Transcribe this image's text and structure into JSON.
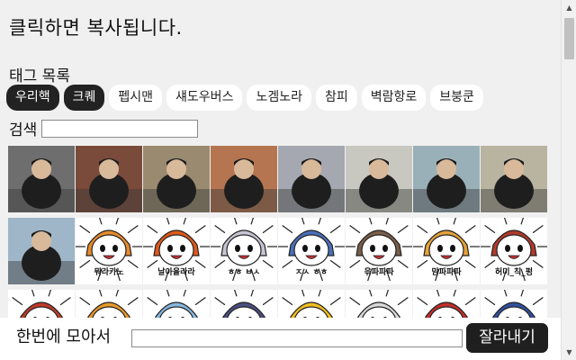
{
  "header": {
    "title": "클릭하면 복사됩니다."
  },
  "tags": {
    "heading": "태그 목록",
    "items": [
      {
        "label": "우리핵",
        "selected": true
      },
      {
        "label": "크퀘",
        "selected": true
      },
      {
        "label": "펩시맨",
        "selected": false
      },
      {
        "label": "섀도우버스",
        "selected": false
      },
      {
        "label": "노겜노라",
        "selected": false
      },
      {
        "label": "참피",
        "selected": false
      },
      {
        "label": "벽람항로",
        "selected": false
      },
      {
        "label": "브붕쿤",
        "selected": false
      }
    ]
  },
  "search": {
    "label": "검색",
    "value": ""
  },
  "stickers": {
    "row1": [
      {
        "name": "photo-1",
        "kind": "photo",
        "bg": "#6e6e6e"
      },
      {
        "name": "photo-2",
        "kind": "photo",
        "bg": "#7a4a3a"
      },
      {
        "name": "photo-3",
        "kind": "photo",
        "bg": "#9a8a70"
      },
      {
        "name": "photo-4",
        "kind": "photo",
        "bg": "#b57550"
      },
      {
        "name": "photo-5",
        "kind": "photo",
        "bg": "#a5a8b0"
      },
      {
        "name": "photo-6",
        "kind": "photo",
        "bg": "#c8c8c0"
      },
      {
        "name": "photo-7",
        "kind": "photo",
        "bg": "#9ab0b8"
      },
      {
        "name": "photo-8",
        "kind": "photo",
        "bg": "#b8b4a0"
      }
    ],
    "row2": [
      {
        "name": "photo-9",
        "kind": "photo",
        "bg": "#9eb6c8",
        "caption": ""
      },
      {
        "name": "cartoon-1",
        "kind": "cartoon",
        "hair": "#e88b2c",
        "caption": "뭐라카노"
      },
      {
        "name": "cartoon-2",
        "kind": "cartoon",
        "hair": "#e05a1c",
        "caption": "날아올라라"
      },
      {
        "name": "cartoon-3",
        "kind": "cartoon",
        "hair": "#c9c4d4",
        "caption": "ㅎㅎ ㅂㅅ"
      },
      {
        "name": "cartoon-4",
        "kind": "cartoon",
        "hair": "#4b6fb8",
        "caption": "ㅈㅅ ㅎㅎ"
      },
      {
        "name": "cartoon-5",
        "kind": "cartoon",
        "hair": "#7a5f4a",
        "caption": "윾파파파"
      },
      {
        "name": "cartoon-6",
        "kind": "cartoon",
        "hair": "#e5a23a",
        "caption": "맘파파파"
      },
      {
        "name": "cartoon-7",
        "kind": "cartoon",
        "hair": "#b33a2a",
        "caption": "허미_칙_펑"
      }
    ],
    "row3": [
      {
        "name": "cartoon-8",
        "kind": "cartoon",
        "hair": "#c23a2a",
        "caption": ""
      },
      {
        "name": "cartoon-9",
        "kind": "cartoon",
        "hair": "#e79a2a",
        "caption": ""
      },
      {
        "name": "cartoon-10",
        "kind": "cartoon",
        "hair": "#87b8e0",
        "caption": ""
      },
      {
        "name": "cartoon-11",
        "kind": "cartoon",
        "hair": "#4a5080",
        "caption": ""
      },
      {
        "name": "cartoon-12",
        "kind": "cartoon",
        "hair": "#f0c020",
        "caption": ""
      },
      {
        "name": "cartoon-13",
        "kind": "cartoon",
        "hair": "#d8d8d8",
        "caption": ""
      },
      {
        "name": "cartoon-14",
        "kind": "cartoon",
        "hair": "#c0302a",
        "caption": ""
      },
      {
        "name": "cartoon-15",
        "kind": "cartoon",
        "hair": "#3050a0",
        "caption": ""
      }
    ]
  },
  "combine": {
    "label": "한번에 모아서",
    "value": "",
    "button_label": "잘라내기"
  },
  "colors": {
    "selected_tag_bg": "#222222",
    "button_bg": "#1f1f1f",
    "panel_bg": "#f0f0f0"
  },
  "icons": {
    "scroll_up": "▲",
    "scroll_down": "▼"
  }
}
